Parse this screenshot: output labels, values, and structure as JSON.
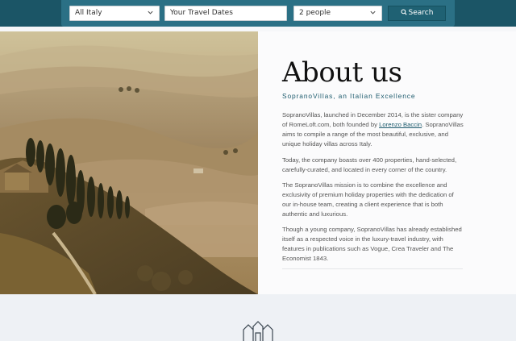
{
  "search": {
    "region_value": "All Italy",
    "dates_placeholder": "Your Travel Dates",
    "guests_value": "2 people",
    "button_label": "Search"
  },
  "about": {
    "title": "About us",
    "subtitle": "SopranoVillas, an Italian Excellence",
    "p1_before": "SopranoVillas, launched in December 2014, is the sister company of RomeLoft.com, both founded by ",
    "p1_link": "Lorenzo Baccin",
    "p1_after": ". SopranoVillas aims to compile a range of the most beautiful, exclusive, and unique holiday villas across Italy.",
    "p2": "Today, the company boasts over 400 properties, hand-selected, carefully-curated, and located in every corner of the country.",
    "p3": "The SopranoVillas mission is to combine the excellence and exclusivity of premium holiday properties with the dedication of our in-house team, creating a client experience that is both authentic and luxurious.",
    "p4": " Though a young company, SopranoVillas has already established itself as a respected voice in the luxury-travel industry, with features in publications such as Vogue, Crea Traveler and The Economist 1843."
  },
  "colors": {
    "header_bg": "#1b5566",
    "search_bg": "#2b7085",
    "accent": "#1d5b6d"
  },
  "icons": {
    "region_chevron": "chevron-down-icon",
    "guests_chevron": "chevron-down-icon",
    "search": "search-icon",
    "logo": "villa-logo-icon"
  }
}
